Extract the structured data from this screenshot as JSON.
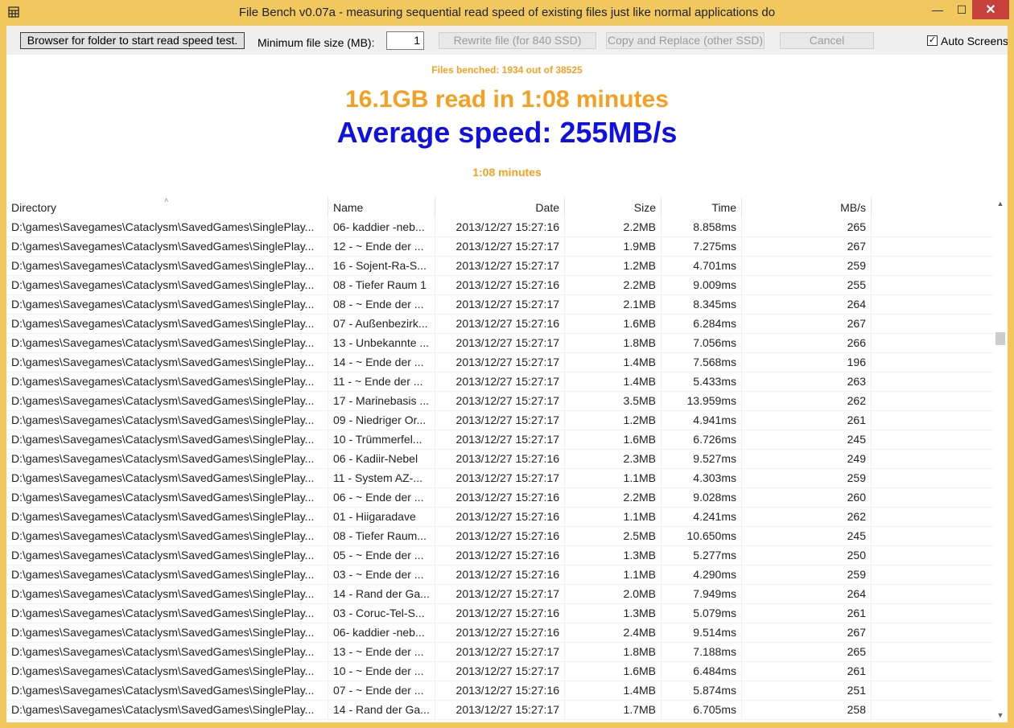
{
  "window": {
    "title": "File Bench v0.07a - measuring sequential read speed of existing files just like normal applications do",
    "minimize_icon": "minimize-icon",
    "maximize_icon": "maximize-icon",
    "close_icon": "close-icon",
    "min_glyph": "—",
    "max_glyph": "☐",
    "close_glyph": "✕",
    "background_color": "#f0c85e"
  },
  "toolbar": {
    "browse_label": "Browser for folder to start read speed test.",
    "min_size_label": "Minimum file size (MB):",
    "min_size_value": "1",
    "rewrite_label": "Rewrite file (for 840 SSD)",
    "copy_replace_label": "Copy and Replace (other SSD)",
    "cancel_label": "Cancel",
    "auto_screenshot_label": "Auto Screens",
    "auto_screenshot_checked": true,
    "check_glyph": "✓"
  },
  "stats": {
    "files_benched": "Files benched: 1934 out of 38525",
    "read_summary": "16.1GB read in  1:08 minutes",
    "average_speed": "Average speed: 255MB/s",
    "elapsed": "1:08 minutes",
    "accent_color": "#f5a020",
    "speed_color": "#1010e6"
  },
  "list": {
    "columns": [
      "Directory",
      "Name",
      "Date",
      "Size",
      "Time",
      "MB/s"
    ],
    "sort_column": "Directory",
    "sort_glyph": "˄",
    "scrollbar": {
      "up_glyph": "▲",
      "down_glyph": "▼",
      "position": 0.25
    },
    "rows": [
      [
        "D:\\games\\Savegames\\Cataclysm\\SavedGames\\SinglePlay...",
        "06- kaddier -neb...",
        "2013/12/27 15:27:16",
        "2.2MB",
        "8.858ms",
        "265"
      ],
      [
        "D:\\games\\Savegames\\Cataclysm\\SavedGames\\SinglePlay...",
        "12 - ~ Ende der ...",
        "2013/12/27 15:27:17",
        "1.9MB",
        "7.275ms",
        "267"
      ],
      [
        "D:\\games\\Savegames\\Cataclysm\\SavedGames\\SinglePlay...",
        "16 - Sojent-Ra-S...",
        "2013/12/27 15:27:17",
        "1.2MB",
        "4.701ms",
        "259"
      ],
      [
        "D:\\games\\Savegames\\Cataclysm\\SavedGames\\SinglePlay...",
        "08 - Tiefer Raum 1",
        "2013/12/27 15:27:16",
        "2.2MB",
        "9.009ms",
        "255"
      ],
      [
        "D:\\games\\Savegames\\Cataclysm\\SavedGames\\SinglePlay...",
        "08 - ~ Ende der ...",
        "2013/12/27 15:27:17",
        "2.1MB",
        "8.345ms",
        "264"
      ],
      [
        "D:\\games\\Savegames\\Cataclysm\\SavedGames\\SinglePlay...",
        "07 - Außenbezirk...",
        "2013/12/27 15:27:16",
        "1.6MB",
        "6.284ms",
        "267"
      ],
      [
        "D:\\games\\Savegames\\Cataclysm\\SavedGames\\SinglePlay...",
        "13 - Unbekannte ...",
        "2013/12/27 15:27:17",
        "1.8MB",
        "7.056ms",
        "266"
      ],
      [
        "D:\\games\\Savegames\\Cataclysm\\SavedGames\\SinglePlay...",
        "14 - ~ Ende der ...",
        "2013/12/27 15:27:17",
        "1.4MB",
        "7.568ms",
        "196"
      ],
      [
        "D:\\games\\Savegames\\Cataclysm\\SavedGames\\SinglePlay...",
        "11 - ~ Ende der ...",
        "2013/12/27 15:27:17",
        "1.4MB",
        "5.433ms",
        "263"
      ],
      [
        "D:\\games\\Savegames\\Cataclysm\\SavedGames\\SinglePlay...",
        "17 - Marinebasis ...",
        "2013/12/27 15:27:17",
        "3.5MB",
        "13.959ms",
        "262"
      ],
      [
        "D:\\games\\Savegames\\Cataclysm\\SavedGames\\SinglePlay...",
        "09 - Niedriger Or...",
        "2013/12/27 15:27:17",
        "1.2MB",
        "4.941ms",
        "261"
      ],
      [
        "D:\\games\\Savegames\\Cataclysm\\SavedGames\\SinglePlay...",
        "10 - Trümmerfel...",
        "2013/12/27 15:27:17",
        "1.6MB",
        "6.726ms",
        "245"
      ],
      [
        "D:\\games\\Savegames\\Cataclysm\\SavedGames\\SinglePlay...",
        "06 - Kadiir-Nebel",
        "2013/12/27 15:27:16",
        "2.3MB",
        "9.527ms",
        "249"
      ],
      [
        "D:\\games\\Savegames\\Cataclysm\\SavedGames\\SinglePlay...",
        "11 - System AZ-...",
        "2013/12/27 15:27:17",
        "1.1MB",
        "4.303ms",
        "259"
      ],
      [
        "D:\\games\\Savegames\\Cataclysm\\SavedGames\\SinglePlay...",
        "06 - ~ Ende der ...",
        "2013/12/27 15:27:16",
        "2.2MB",
        "9.028ms",
        "260"
      ],
      [
        "D:\\games\\Savegames\\Cataclysm\\SavedGames\\SinglePlay...",
        "01 - Hiigaradave",
        "2013/12/27 15:27:16",
        "1.1MB",
        "4.241ms",
        "262"
      ],
      [
        "D:\\games\\Savegames\\Cataclysm\\SavedGames\\SinglePlay...",
        "08 - Tiefer Raum...",
        "2013/12/27 15:27:16",
        "2.5MB",
        "10.650ms",
        "245"
      ],
      [
        "D:\\games\\Savegames\\Cataclysm\\SavedGames\\SinglePlay...",
        "05 - ~ Ende der ...",
        "2013/12/27 15:27:16",
        "1.3MB",
        "5.277ms",
        "250"
      ],
      [
        "D:\\games\\Savegames\\Cataclysm\\SavedGames\\SinglePlay...",
        "03 - ~ Ende der ...",
        "2013/12/27 15:27:16",
        "1.1MB",
        "4.290ms",
        "259"
      ],
      [
        "D:\\games\\Savegames\\Cataclysm\\SavedGames\\SinglePlay...",
        "14 - Rand der Ga...",
        "2013/12/27 15:27:17",
        "2.0MB",
        "7.949ms",
        "264"
      ],
      [
        "D:\\games\\Savegames\\Cataclysm\\SavedGames\\SinglePlay...",
        "03 - Coruc-Tel-S...",
        "2013/12/27 15:27:16",
        "1.3MB",
        "5.079ms",
        "261"
      ],
      [
        "D:\\games\\Savegames\\Cataclysm\\SavedGames\\SinglePlay...",
        "06- kaddier -neb...",
        "2013/12/27 15:27:16",
        "2.4MB",
        "9.514ms",
        "267"
      ],
      [
        "D:\\games\\Savegames\\Cataclysm\\SavedGames\\SinglePlay...",
        "13 - ~ Ende der ...",
        "2013/12/27 15:27:17",
        "1.8MB",
        "7.188ms",
        "265"
      ],
      [
        "D:\\games\\Savegames\\Cataclysm\\SavedGames\\SinglePlay...",
        "10 - ~ Ende der ...",
        "2013/12/27 15:27:17",
        "1.6MB",
        "6.484ms",
        "261"
      ],
      [
        "D:\\games\\Savegames\\Cataclysm\\SavedGames\\SinglePlay...",
        "07 - ~ Ende der ...",
        "2013/12/27 15:27:16",
        "1.4MB",
        "5.874ms",
        "251"
      ],
      [
        "D:\\games\\Savegames\\Cataclysm\\SavedGames\\SinglePlay...",
        "14 - Rand der Ga...",
        "2013/12/27 15:27:17",
        "1.7MB",
        "6.705ms",
        "258"
      ]
    ]
  }
}
